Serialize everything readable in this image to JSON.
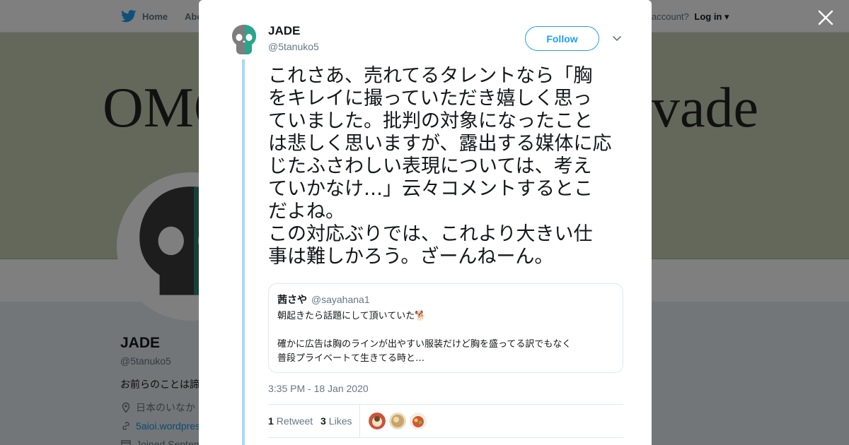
{
  "background": {
    "nav": {
      "home": "Home",
      "about": "Abo",
      "account_prompt": "account?",
      "login": "Log in"
    },
    "banner": {
      "text_left": "OMO",
      "text_right": "vade"
    },
    "profile": {
      "name": "JADE",
      "handle": "@5tanuko5",
      "bio": "お前らのことは諦",
      "location": "日本のいなか",
      "url": "5aioi.wordpres",
      "joined": "Joined Septem"
    }
  },
  "tweet": {
    "author_name": "JADE",
    "author_handle": "@5tanuko5",
    "follow_label": "Follow",
    "text": "これさあ、売れてるタレントなら「胸\nをキレイに撮っていただき嬉しく思っ\nていました。批判の対象になったこと\nは悲しく思いますが、露出する媒体に応\nじたふさわしい表現については、考え\nていかなけ…」云々コメントするとこ\nだよね。\nこの対応ぶりでは、これより大きい仕\n事は難しかろう。ざーんねーん。",
    "quote": {
      "name": "茜さや",
      "handle": "@sayahana1",
      "text": "朝起きたら話題にして頂いていた🐕\n\n確かに広告は胸のラインが出やすい服装だけど胸を盛ってる訳でもなく\n普段プライベートて生きてる時と…"
    },
    "timestamp": "3:35 PM - 18 Jan 2020",
    "retweet_count": "1",
    "retweet_label": "Retweet",
    "like_count": "3",
    "like_label": "Likes"
  },
  "colors": {
    "accent": "#1da1f2",
    "thread_line": "#a7d9f5",
    "banner": "#c8d0b5"
  }
}
